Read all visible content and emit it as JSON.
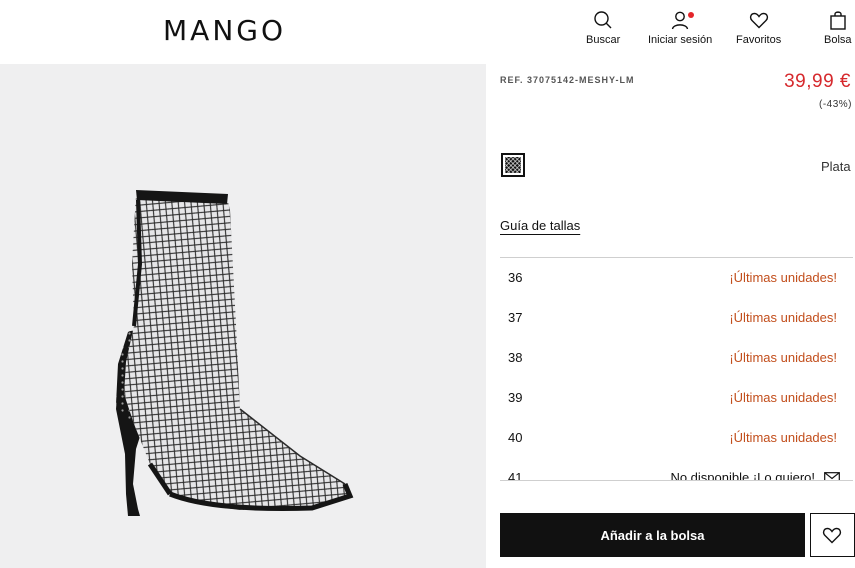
{
  "header": {
    "logo": "MANGO",
    "nav": {
      "search_label": "Buscar",
      "login_label": "Iniciar sesión",
      "favorites_label": "Favoritos",
      "bag_label": "Bolsa"
    }
  },
  "product": {
    "ref": "REF. 37075142-MESHY-LM",
    "price": "39,99 €",
    "discount": "(-43%)",
    "color_name": "Plata",
    "size_guide_label": "Guía de tallas",
    "sizes": [
      {
        "size": "36",
        "status": "¡Últimas unidades!"
      },
      {
        "size": "37",
        "status": "¡Últimas unidades!"
      },
      {
        "size": "38",
        "status": "¡Últimas unidades!"
      },
      {
        "size": "39",
        "status": "¡Últimas unidades!"
      },
      {
        "size": "40",
        "status": "¡Últimas unidades!"
      },
      {
        "size": "41",
        "status": "No disponible ¡Lo quiero!"
      }
    ],
    "add_to_bag_label": "Añadir a la bolsa"
  },
  "colors": {
    "price": "#d6292d",
    "low_stock": "#c24e1c",
    "button": "#111111",
    "notification_dot": "#e4252a"
  }
}
